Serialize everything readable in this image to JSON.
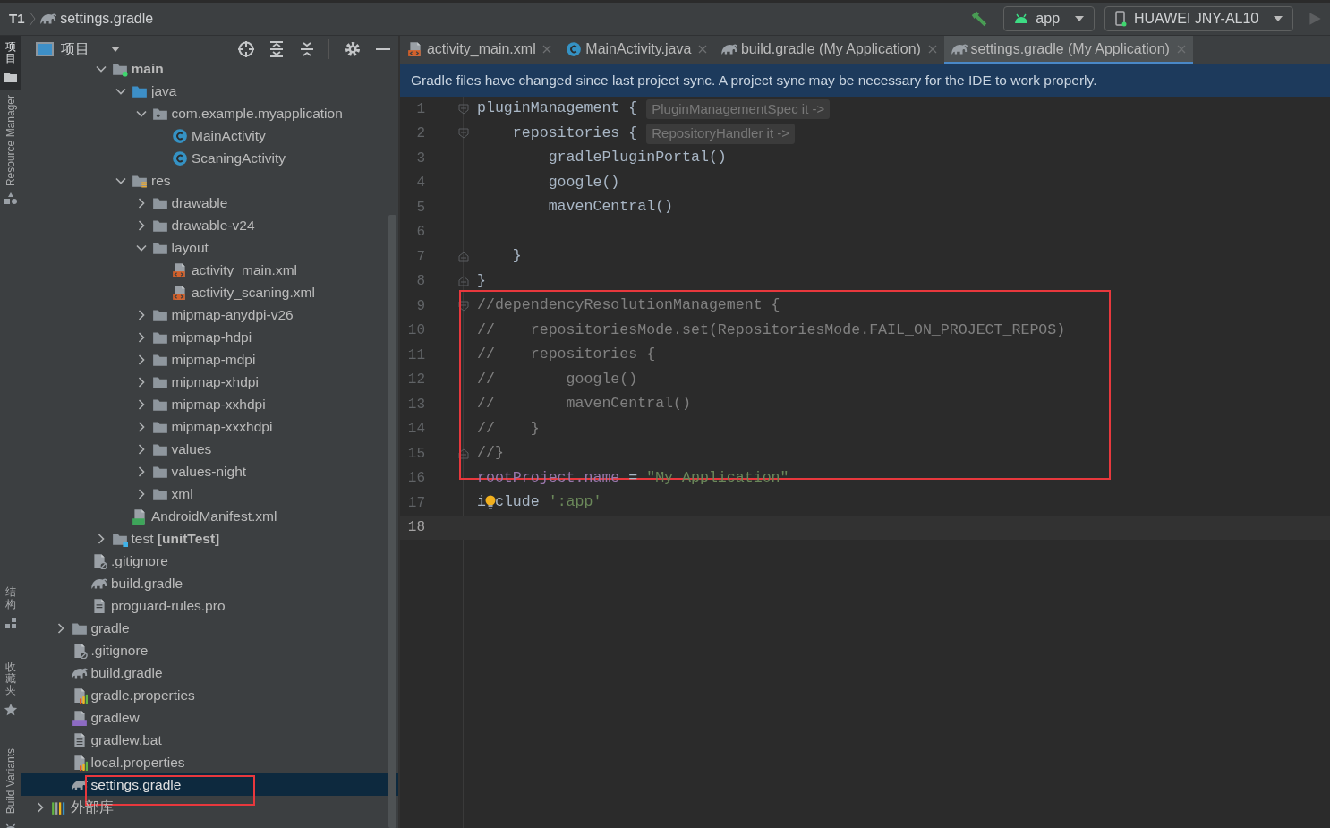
{
  "title_bar": {
    "project": "T1",
    "file": "settings.gradle",
    "run_config": "app",
    "device": "HUAWEI JNY-AL10"
  },
  "tool_strip": {
    "top": [
      {
        "label": "项目",
        "selected": true
      },
      {
        "label": "Resource Manager",
        "selected": false
      }
    ],
    "bottom": [
      {
        "label": "结构",
        "selected": false
      },
      {
        "label": "收藏夹",
        "selected": false
      },
      {
        "label": "Build Variants",
        "selected": false
      }
    ]
  },
  "panel": {
    "title": "项目"
  },
  "tree": [
    {
      "children": [
        {
          "children": [
            {
              "children": [
                {
                  "label": "main",
                  "kind": "folder-source",
                  "bold": true,
                  "expanded": true,
                  "selected": false,
                  "children": [
                    {
                      "label": "java",
                      "kind": "folder-java",
                      "expanded": true,
                      "selected": false,
                      "children": [
                        {
                          "label": "com.example.myapplication",
                          "kind": "package",
                          "expanded": true,
                          "selected": false,
                          "children": [
                            {
                              "label": "MainActivity",
                              "kind": "class",
                              "selected": false
                            },
                            {
                              "label": "ScaningActivity",
                              "kind": "class",
                              "selected": false
                            }
                          ]
                        }
                      ]
                    },
                    {
                      "label": "res",
                      "kind": "folder-res",
                      "expanded": true,
                      "selected": false,
                      "children": [
                        {
                          "label": "drawable",
                          "kind": "folder",
                          "expanded": false,
                          "selected": false
                        },
                        {
                          "label": "drawable-v24",
                          "kind": "folder",
                          "expanded": false,
                          "selected": false
                        },
                        {
                          "label": "layout",
                          "kind": "folder",
                          "expanded": true,
                          "selected": false,
                          "children": [
                            {
                              "label": "activity_main.xml",
                              "kind": "xml-layout",
                              "selected": false
                            },
                            {
                              "label": "activity_scaning.xml",
                              "kind": "xml-layout",
                              "selected": false
                            }
                          ]
                        },
                        {
                          "label": "mipmap-anydpi-v26",
                          "kind": "folder",
                          "expanded": false,
                          "selected": false
                        },
                        {
                          "label": "mipmap-hdpi",
                          "kind": "folder",
                          "expanded": false,
                          "selected": false
                        },
                        {
                          "label": "mipmap-mdpi",
                          "kind": "folder",
                          "expanded": false,
                          "selected": false
                        },
                        {
                          "label": "mipmap-xhdpi",
                          "kind": "folder",
                          "expanded": false,
                          "selected": false
                        },
                        {
                          "label": "mipmap-xxhdpi",
                          "kind": "folder",
                          "expanded": false,
                          "selected": false
                        },
                        {
                          "label": "mipmap-xxxhdpi",
                          "kind": "folder",
                          "expanded": false,
                          "selected": false
                        },
                        {
                          "label": "values",
                          "kind": "folder",
                          "expanded": false,
                          "selected": false
                        },
                        {
                          "label": "values-night",
                          "kind": "folder",
                          "expanded": false,
                          "selected": false
                        },
                        {
                          "label": "xml",
                          "kind": "folder",
                          "expanded": false,
                          "selected": false
                        }
                      ]
                    },
                    {
                      "label": "AndroidManifest.xml",
                      "kind": "manifest",
                      "selected": false
                    }
                  ]
                },
                {
                  "label": "test **[unitTest]**",
                  "kind": "folder-test",
                  "expanded": false,
                  "selected": false
                }
              ]
            },
            {
              "label": ".gitignore",
              "kind": "gitignore",
              "selected": false
            },
            {
              "label": "build.gradle",
              "kind": "gradle",
              "selected": false
            },
            {
              "label": "proguard-rules.pro",
              "kind": "text-file",
              "selected": false
            }
          ]
        },
        {
          "label": "gradle",
          "kind": "folder",
          "expanded": false,
          "selected": false
        },
        {
          "label": ".gitignore",
          "kind": "gitignore",
          "selected": false
        },
        {
          "label": "build.gradle",
          "kind": "gradle",
          "selected": false
        },
        {
          "label": "gradle.properties",
          "kind": "properties",
          "selected": false
        },
        {
          "label": "gradlew",
          "kind": "script",
          "selected": false
        },
        {
          "label": "gradlew.bat",
          "kind": "text-file",
          "selected": false
        },
        {
          "label": "local.properties",
          "kind": "properties",
          "selected": false
        },
        {
          "label": "settings.gradle",
          "kind": "gradle",
          "selected": true,
          "boxed": true
        }
      ]
    },
    {
      "label": "外部库",
      "kind": "library",
      "expanded": false,
      "selected": false
    }
  ],
  "editor": {
    "tabs": [
      {
        "label": "activity_main.xml",
        "kind": "xml-layout",
        "selected": false
      },
      {
        "label": "MainActivity.java",
        "kind": "class",
        "selected": false
      },
      {
        "label": "build.gradle (My Application)",
        "kind": "gradle",
        "selected": false
      },
      {
        "label": "settings.gradle (My Application)",
        "kind": "gradle",
        "selected": true
      }
    ],
    "banner": "Gradle files have changed since last project sync. A project sync may be necessary for the IDE to work properly.",
    "blocks": [
      {
        "lines": [
          {
            "number": "1",
            "fold_open": true,
            "current": false,
            "tokens": [
              {
                "kind": "code",
                "text": "pluginManagement { "
              },
              {
                "kind": "hint",
                "text": "PluginManagementSpec it ->"
              }
            ]
          },
          {
            "number": "2",
            "fold_open": true,
            "current": false,
            "tokens": [
              {
                "kind": "code",
                "text": "    repositories { "
              },
              {
                "kind": "hint",
                "text": "RepositoryHandler it ->"
              }
            ]
          },
          {
            "number": "3",
            "current": false,
            "tokens": [
              {
                "kind": "code",
                "text": "        gradlePluginPortal()"
              }
            ]
          },
          {
            "number": "4",
            "current": false,
            "tokens": [
              {
                "kind": "code",
                "text": "        google()"
              }
            ]
          },
          {
            "number": "5",
            "current": false,
            "tokens": [
              {
                "kind": "code",
                "text": "        mavenCentral()"
              }
            ]
          },
          {
            "number": "6",
            "current": false
          },
          {
            "number": "7",
            "fold_close": true,
            "current": false,
            "tokens": [
              {
                "kind": "code",
                "text": "    }"
              }
            ]
          },
          {
            "number": "8",
            "fold_close": true,
            "current": false,
            "tokens": [
              {
                "kind": "code",
                "text": "}"
              }
            ]
          }
        ]
      },
      {
        "boxed": true,
        "lines": [
          {
            "number": "9",
            "fold_open": true,
            "current": false,
            "tokens": [
              {
                "kind": "comment",
                "text": "//dependencyResolutionManagement {"
              }
            ]
          },
          {
            "number": "10",
            "current": false,
            "tokens": [
              {
                "kind": "comment",
                "text": "//    repositoriesMode.set(RepositoriesMode.FAIL_ON_PROJECT_REPOS)"
              }
            ]
          },
          {
            "number": "11",
            "current": false,
            "tokens": [
              {
                "kind": "comment",
                "text": "//    repositories {"
              }
            ]
          },
          {
            "number": "12",
            "current": false,
            "tokens": [
              {
                "kind": "comment",
                "text": "//        google()"
              }
            ]
          },
          {
            "number": "13",
            "current": false,
            "tokens": [
              {
                "kind": "comment",
                "text": "//        mavenCentral()"
              }
            ]
          },
          {
            "number": "14",
            "current": false,
            "tokens": [
              {
                "kind": "comment",
                "text": "//    }"
              }
            ]
          },
          {
            "number": "15",
            "fold_close": true,
            "current": false,
            "tokens": [
              {
                "kind": "comment",
                "text": "//}"
              }
            ]
          }
        ]
      },
      {
        "lines": [
          {
            "number": "16",
            "current": false,
            "tokens": [
              {
                "kind": "field",
                "text": "rootProject.name"
              },
              {
                "kind": "code",
                "text": " = "
              },
              {
                "kind": "string",
                "text": "\"My Application\""
              }
            ]
          },
          {
            "number": "17",
            "current": false,
            "tokens": [
              {
                "kind": "code",
                "text": "i"
              },
              {
                "kind": "bulb"
              },
              {
                "kind": "code",
                "text": "clude "
              },
              {
                "kind": "string",
                "text": "':app'"
              }
            ]
          },
          {
            "number": "18",
            "current": true
          }
        ]
      }
    ]
  }
}
